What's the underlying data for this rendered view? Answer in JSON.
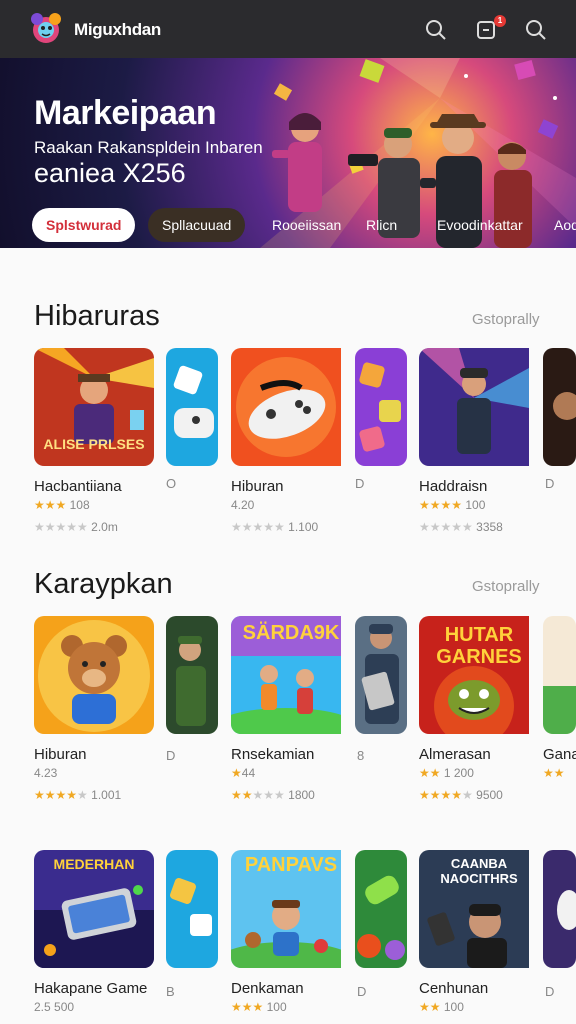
{
  "app": {
    "name": "Miguxhdan",
    "notification_count": "1"
  },
  "hero": {
    "title": "Markeipaan",
    "subtitle": "Raakan Rakanspldein Inbaren",
    "subtitle2": "eaniea X256",
    "chips": [
      "Splstwurad",
      "Spllacuuad",
      "Rooeiissan",
      "Rlicn",
      "Evoodinkattar",
      "Aod"
    ]
  },
  "sections": [
    {
      "title": "Hibaruras",
      "link": "Gstoprally",
      "cards": [
        {
          "name": "Hacbantiiana",
          "rating": "108",
          "meta": "2.0m",
          "thumb_text": "ALISE PRLSES"
        },
        {
          "name": "Hiburan",
          "rating": "4.20",
          "meta": "1.100"
        },
        {
          "name": "Haddraisn",
          "rating": "100",
          "meta": "3358"
        }
      ],
      "side_marks": [
        "O",
        "D",
        "D"
      ]
    },
    {
      "title": "Karaypkan",
      "link": "Gstoprally",
      "cards": [
        {
          "name": "Hiburan",
          "rating": "4.23",
          "meta": "1.001"
        },
        {
          "name": "Rnsekamian",
          "rating": "44",
          "meta": "1800",
          "thumb_text": "SÄRDA9K"
        },
        {
          "name": "Almerasan",
          "rating": "1 200",
          "meta": "9500",
          "thumb_text": "HUTAR GARNES"
        },
        {
          "name": "Gana"
        }
      ],
      "side_marks": [
        "D",
        "8"
      ]
    },
    {
      "title": "",
      "cards": [
        {
          "name": "Hakapane Game",
          "rating": "2.5 500",
          "thumb_text": "MEDERHAN"
        },
        {
          "name": "Denkaman",
          "rating": "100",
          "thumb_text": "PANPAVS"
        },
        {
          "name": "Cenhunan",
          "rating": "100",
          "thumb_text": "CAANBA NAOCITHRS"
        }
      ],
      "side_marks": [
        "B",
        "D",
        "D"
      ]
    }
  ]
}
